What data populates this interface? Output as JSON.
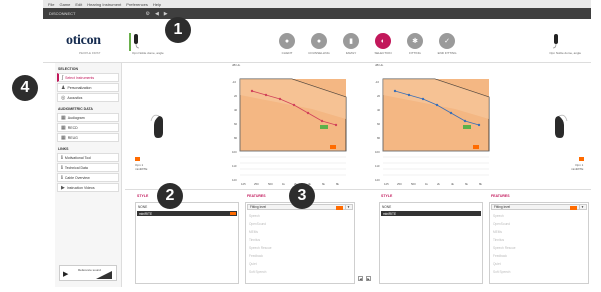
{
  "menubar": {
    "items": [
      "File",
      "Game",
      "Edit",
      "Hearing Instrument",
      "Preferences",
      "Help"
    ]
  },
  "appbar": {
    "title": "DISCONNECT"
  },
  "brand": {
    "logo": "oticon",
    "tagline": "PEOPLE FIRST"
  },
  "devices": {
    "left_label": "Opn Noble dome, angle",
    "right_label": "Opn Noble dome, angle"
  },
  "nav": [
    {
      "label": "CLIENT",
      "icon": "client-icon"
    },
    {
      "label": "COUNSELLING",
      "icon": "counselling-icon"
    },
    {
      "label": "FAMILY",
      "icon": "family-icon"
    },
    {
      "label": "SELECTION",
      "icon": "selection-icon"
    },
    {
      "label": "FITTING",
      "icon": "fitting-icon"
    },
    {
      "label": "END FITTING",
      "icon": "end-fitting-icon"
    }
  ],
  "sidebar": {
    "selection": {
      "title": "SELECTION",
      "items": [
        "Select Instruments",
        "Personalization",
        "Acoustics"
      ]
    },
    "audiometric": {
      "title": "AUDIOMETRIC DATA",
      "items": [
        "Audiogram",
        "RECD",
        "REUG"
      ]
    },
    "links": {
      "title": "LINKS",
      "items": [
        "Motivational Tool",
        "Technical Data",
        "Cable Overview",
        "Instruction Videos"
      ]
    },
    "reference": "Reference sound"
  },
  "audiogram": {
    "unit": "dB HL",
    "side_left": "Opn 1\nminiRITE",
    "side_right": "Opn 1\nminiRITE",
    "hz_label": "Hz"
  },
  "styles_left": {
    "title": "STYLE",
    "option_header": "NONE",
    "selected": "miniRITE"
  },
  "features_left": {
    "title": "FEATURES",
    "fitting_level": "Fitting level",
    "rows": [
      "Speech",
      "OpenSound",
      "MEMs",
      "Tinnitus",
      "Speech Rescue",
      "Feedback",
      "Quiet",
      "Soft Speech"
    ]
  },
  "styles_right": {
    "title": "STYLE",
    "option_header": "NONE",
    "selected": "miniRITE"
  },
  "features_right": {
    "title": "FEATURES",
    "fitting_level": "Fitting level",
    "rows": [
      "Speech",
      "OpenSound",
      "MEMs",
      "Tinnitus",
      "Speech Rescue",
      "Feedback",
      "Quiet",
      "Soft Speech"
    ]
  },
  "badges": [
    "1",
    "2",
    "3",
    "4"
  ],
  "colors": {
    "accent": "#c2185b",
    "orange": "#ff6b00",
    "chart_bg": "#f4b783",
    "dark": "#2d2d2d"
  }
}
